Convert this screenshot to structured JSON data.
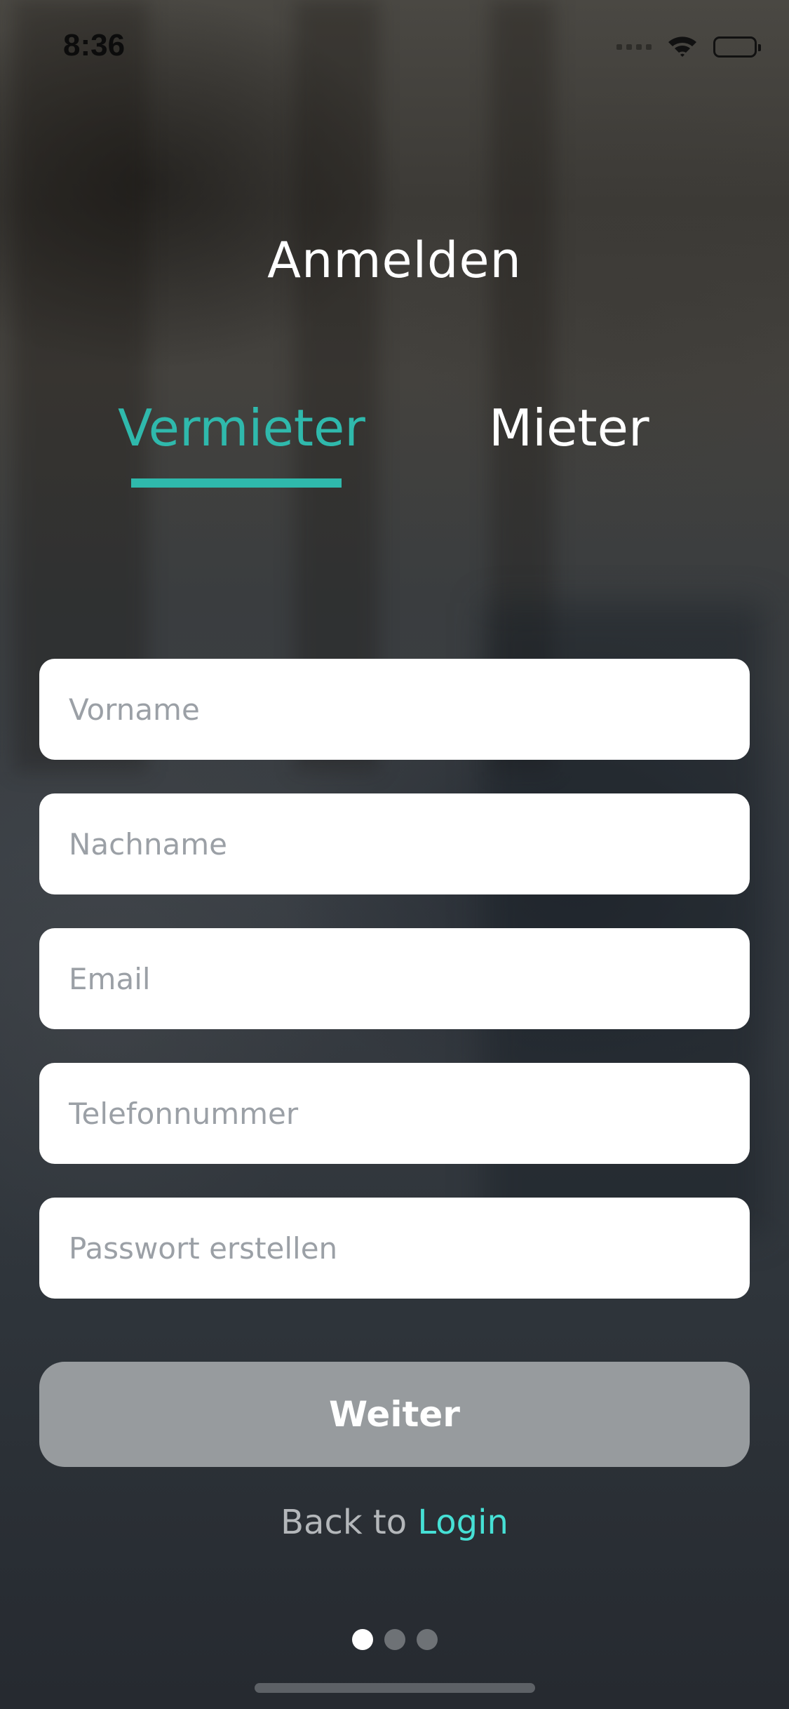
{
  "status_bar": {
    "time": "8:36"
  },
  "header": {
    "title": "Anmelden"
  },
  "tabs": [
    {
      "label": "Vermieter",
      "selected": true
    },
    {
      "label": "Mieter",
      "selected": false
    }
  ],
  "form": {
    "fields": [
      {
        "placeholder": "Vorname",
        "value": ""
      },
      {
        "placeholder": "Nachname",
        "value": ""
      },
      {
        "placeholder": "Email",
        "value": ""
      },
      {
        "placeholder": "Telefonnummer",
        "value": ""
      },
      {
        "placeholder": "Passwort erstellen",
        "value": ""
      }
    ],
    "submit_label": "Weiter"
  },
  "footer": {
    "back_text": "Back to",
    "login_label": "Login"
  },
  "pagination": {
    "current_page": 1,
    "total_pages": 3
  },
  "colors": {
    "accent": "#2fb9ac",
    "link": "#46e0d5",
    "button_disabled": "#979b9e"
  },
  "icons": {
    "signal": "cellular-signal-icon",
    "wifi": "wifi-icon",
    "battery": "battery-icon"
  }
}
